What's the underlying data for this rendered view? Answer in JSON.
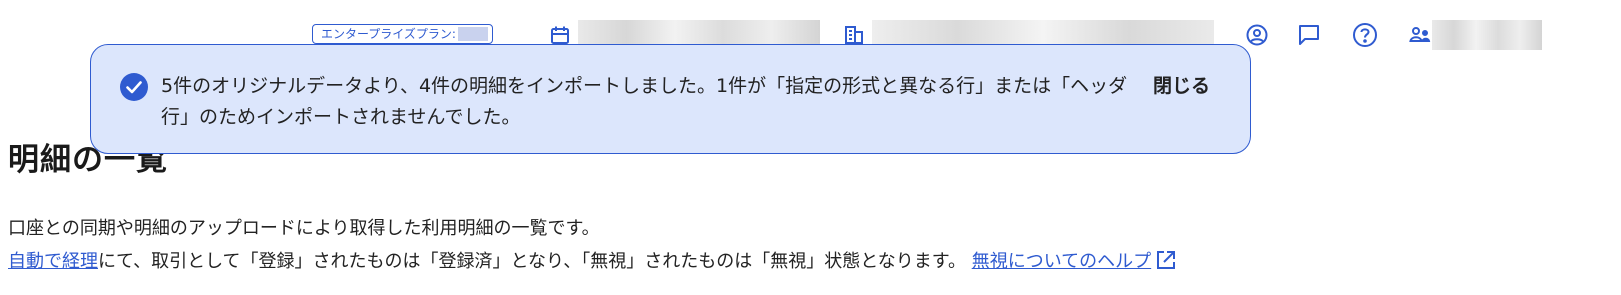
{
  "header": {
    "plan_label": "エンタープライズプラン:",
    "icons": [
      "calendar-icon",
      "office-icon",
      "account-circle-icon",
      "chat-icon",
      "help-icon",
      "users-icon"
    ]
  },
  "page": {
    "title": "明細の一覧",
    "description_line1": "口座との同期や明細のアップロードにより取得した利用明細の一覧です。",
    "auto_link": "自動で経理",
    "description_line2": "にて、取引として「登録」されたものは「登録済」となり、「無視」されたものは「無視」状態となります。",
    "help_link": "無視についてのヘルプ"
  },
  "toast": {
    "message": "5件のオリジナルデータより、4件の明細をインポートしました。1件が「指定の形式と異なる行」または「ヘッダ行」のためインポートされませんでした。",
    "close_label": "閉じる"
  },
  "colors": {
    "accent": "#2f5bd0",
    "toast_bg": "#dce6fc"
  }
}
